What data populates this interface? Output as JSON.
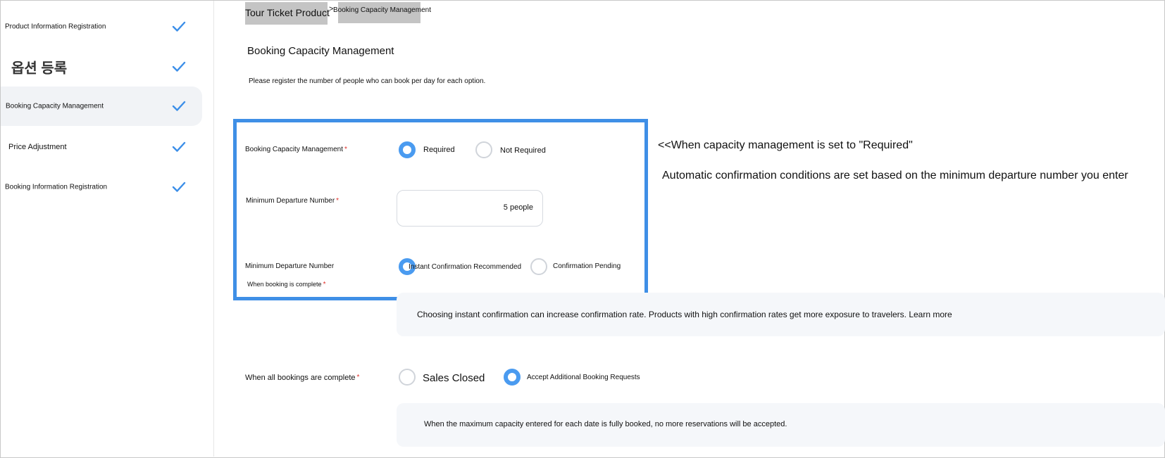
{
  "sidebar": {
    "items": [
      {
        "label": "Product Information Registration"
      },
      {
        "label": "옵션 등록"
      },
      {
        "label": "Booking Capacity Management"
      },
      {
        "label": "Price Adjustment"
      },
      {
        "label": "Booking Information Registration"
      }
    ]
  },
  "breadcrumb": {
    "root": "Tour Ticket Product",
    "separator": ">",
    "current": "Booking Capacity Management"
  },
  "page": {
    "title": "Booking Capacity Management",
    "description": "Please register the number of people who can book per day for each option."
  },
  "form": {
    "capacity": {
      "label": "Booking Capacity Management",
      "option_required": "Required",
      "option_not_required": "Not Required",
      "selected": "Required"
    },
    "min_departure": {
      "label": "Minimum Departure Number",
      "value": "5 people"
    },
    "min_departure_complete": {
      "label_line1": "Minimum Departure Number",
      "label_line2": "When booking is complete",
      "option_instant": "Instant Confirmation Recommended",
      "option_pending": "Confirmation Pending",
      "selected": "Instant Confirmation Recommended",
      "info": "Choosing instant confirmation can increase confirmation rate. Products with high confirmation rates get more exposure to travelers. Learn more"
    },
    "all_complete": {
      "label": "When all bookings are complete",
      "option_closed": "Sales Closed",
      "option_accept": "Accept Additional Booking Requests",
      "selected": "Accept Additional Booking Requests",
      "info": "When the maximum capacity entered for each date is fully booked, no more reservations will be accepted."
    },
    "required_mark": "*"
  },
  "annotation": {
    "line1": "<<When capacity management is set to \"Required\"",
    "line2": "Automatic confirmation conditions are set based on the minimum departure number you enter"
  },
  "colors": {
    "accent": "#4a9bf0",
    "highlight": "#3f8fe6",
    "required": "#e0302a"
  },
  "icons": {
    "check": "checkmark-icon"
  }
}
